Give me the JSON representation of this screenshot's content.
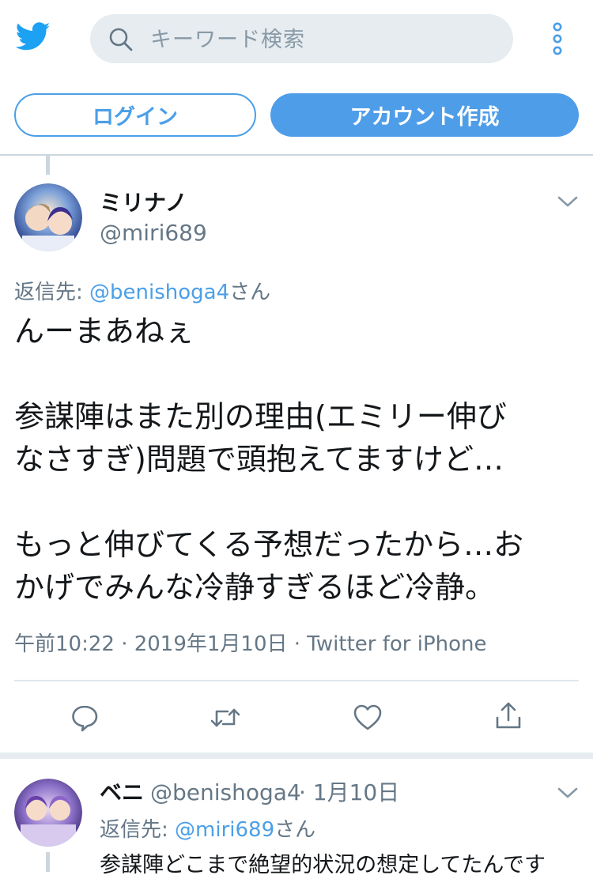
{
  "header": {
    "search_placeholder": "キーワード検索",
    "login_label": "ログイン",
    "signup_label": "アカウント作成"
  },
  "tweet": {
    "display_name": "ミリナノ",
    "handle": "@miri689",
    "reply_prefix": "返信先:",
    "reply_mention": "@benishoga4",
    "reply_suffix": "さん",
    "lines": [
      "んーまあねぇ",
      "",
      "参謀陣はまた別の理由(エミリー伸び",
      "なさすぎ)問題で頭抱えてますけど…",
      "",
      "もっと伸びてくる予想だったから…お",
      "かげでみんな冷静すぎるほど冷静。"
    ],
    "meta": "午前10:22 · 2019年1月10日 · Twitter for iPhone",
    "actions": [
      "reply",
      "retweet",
      "like",
      "share"
    ]
  },
  "reply_tweet": {
    "display_name": "ベニ",
    "handle": "@benishoga4",
    "date": "· 1月10日",
    "reply_prefix": "返信先:",
    "reply_mention": "@miri689",
    "reply_suffix": "さん",
    "text_partial": "参謀陣どこまで絶望的状況の想定してたんです"
  },
  "colors": {
    "accent": "#4b9fe8",
    "secondary_text": "#657786",
    "divider": "#ccd6dd"
  }
}
